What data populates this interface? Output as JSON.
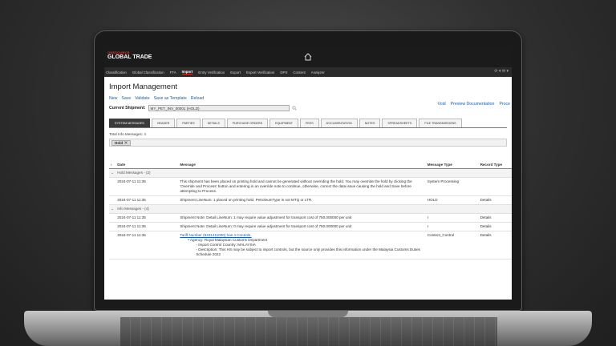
{
  "app": {
    "brand_small": "ONESOURCE",
    "brand": "GLOBAL TRADE"
  },
  "nav": {
    "items": [
      "Classification",
      "Global Classification",
      "FTA",
      "Import",
      "Entry Verification",
      "Export",
      "Export Verification",
      "DPS",
      "Content",
      "Analyzer"
    ],
    "active": "Import",
    "right": "⟳ ▾  ✉ ▾"
  },
  "page": {
    "title": "Import Management",
    "actions": [
      "New",
      "Save",
      "Validate",
      "Save as Template",
      "Reload"
    ],
    "actions_right": [
      "Void",
      "Preview Documentation",
      "Proce"
    ],
    "shipment_label": "Current Shipment:",
    "shipment_value": "MY_PET_INV_00001 (HOLD)"
  },
  "tabs": [
    "SYSTEM MESSAGES",
    "HEADER",
    "PARTIES",
    "DETAILS",
    "PURCHASE ORDERS",
    "EQUIPMENT",
    "FEES",
    "DOCUMENTATION",
    "NOTES",
    "SPREADSHEETS",
    "FILE TRANSMISSIONS"
  ],
  "active_tab": "SYSTEM MESSAGES",
  "summary": {
    "info_messages": "Total Info Messages: 4",
    "hold_chip": "Hold"
  },
  "table": {
    "headers": [
      "Date",
      "Message",
      "Message Type",
      "Record Type"
    ],
    "group_hold": "Hold Messages - (2)",
    "group_info": "Info Messages - (4)",
    "rows": [
      {
        "date": "2024-07-11 11:35",
        "message": "This shipment has been placed on printing hold and cannot be generated without overriding the hold. You may override the hold by clicking the 'Override and Process' button and entering in an override note to continue, otherwise, correct the data issue causing the hold and Save before attempting to Process.",
        "type": "System Processing",
        "record": ""
      },
      {
        "date": "2024-07-11 11:35",
        "message": "Shipment LineNum: 1 placed on printing hold. PetroleumType is not MTQ or LTR.",
        "type": "HOLD",
        "record": "Details"
      },
      {
        "date": "2024-07-11 11:35",
        "message": "Shipment Note: Detail LineNum: 1 may require value adjustment for transport cost of 750.000000 per unit",
        "type": "I",
        "record": "Details"
      },
      {
        "date": "2024-07-11 11:35",
        "message": "Shipment Note: Detail LineNum: 0 may require value adjustment for transport cost of 750.000000 per unit",
        "type": "I",
        "record": "Details"
      },
      {
        "date": "2024-07-11 11:35",
        "link": "Tariff Number (8431411000) has 4 Controls.",
        "agency": "Agency: Royal Malaysian Customs Department",
        "country": "Import Control Country: MALAYSIA",
        "description": "Description: This HS may be subject to import controls, but the source only provides this information under the Malaysia Customs Duties Schedule 2022",
        "type": "Content_Control",
        "record": "Details"
      }
    ]
  }
}
